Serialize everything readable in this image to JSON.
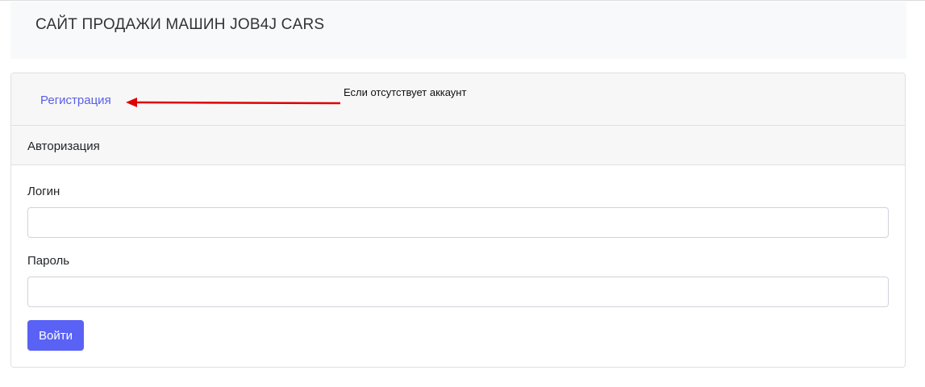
{
  "navbar": {
    "brand": "САЙТ ПРОДАЖИ МАШИН JOB4J CARS"
  },
  "card": {
    "nav": {
      "register_link": "Регистрация",
      "annotation": "Если отсутствует аккаунт",
      "annotation_color": "#e00000"
    },
    "header_title": "Авторизация",
    "form": {
      "login_label": "Логин",
      "login_value": "",
      "password_label": "Пароль",
      "password_value": "",
      "submit_label": "Войти"
    }
  },
  "colors": {
    "accent": "#5a62f5",
    "link": "#5a5ee6",
    "navbar_bg": "#f8f9fa",
    "card_header_bg": "#f7f7f7"
  }
}
